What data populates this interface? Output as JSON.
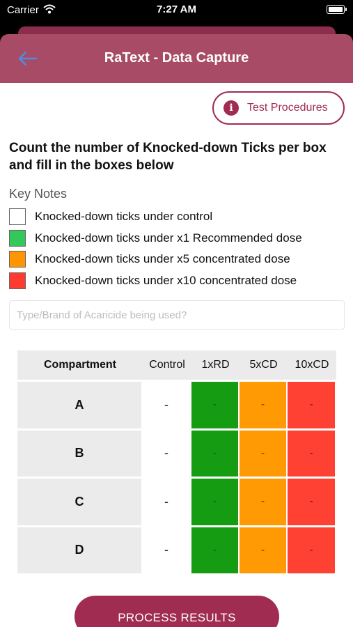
{
  "status_bar": {
    "carrier": "Carrier",
    "time": "7:27 AM",
    "icons": [
      "wifi-icon",
      "battery-icon"
    ]
  },
  "header": {
    "title": "RaText - Data Capture",
    "back_icon": "arrow-left-icon",
    "color": "#a84b67"
  },
  "test_procedures": {
    "label": "Test Procedures",
    "icon": "info-icon",
    "accent": "#a02c52"
  },
  "instruction": "Count the number of Knocked-down Ticks per box and fill in the boxes below",
  "key_notes": {
    "title": "Key Notes",
    "items": [
      {
        "label": "Knocked-down ticks under control",
        "color": "#ffffff"
      },
      {
        "label": "Knocked-down ticks under x1 Recommended dose",
        "color": "#34c759"
      },
      {
        "label": "Knocked-down ticks under x5 concentrated dose",
        "color": "#ff9500"
      },
      {
        "label": "Knocked-down ticks under x10 concentrated dose",
        "color": "#ff3b30"
      }
    ]
  },
  "acaricide_input": {
    "placeholder": "Type/Brand of Acaricide being used?",
    "value": ""
  },
  "table": {
    "headers": [
      "Compartment",
      "Control",
      "1xRD",
      "5xCD",
      "10xCD"
    ],
    "rows": [
      {
        "compartment": "A",
        "values": [
          "-",
          "-",
          "-",
          "-"
        ]
      },
      {
        "compartment": "B",
        "values": [
          "-",
          "-",
          "-",
          "-"
        ]
      },
      {
        "compartment": "C",
        "values": [
          "-",
          "-",
          "-",
          "-"
        ]
      },
      {
        "compartment": "D",
        "values": [
          "-",
          "-",
          "-",
          "-"
        ]
      }
    ]
  },
  "process_button": {
    "label": "PROCESS RESULTS"
  }
}
